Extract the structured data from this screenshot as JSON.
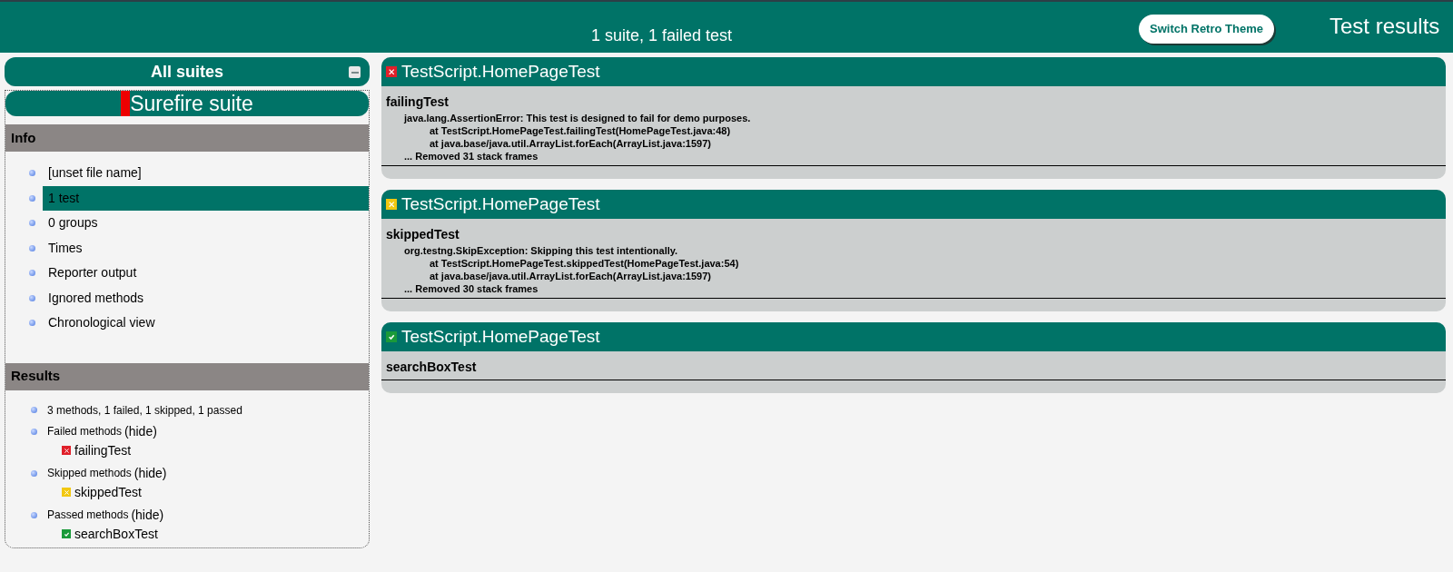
{
  "header": {
    "summary": "1 suite, 1 failed test",
    "theme_button": "Switch Retro Theme",
    "title": "Test results"
  },
  "sidebar": {
    "all_suites": "All suites",
    "suite": {
      "name": "Surefire suite",
      "failed": true
    },
    "info": {
      "heading": "Info",
      "items": [
        {
          "label": "[unset file name]",
          "selected": false
        },
        {
          "label": "1 test",
          "selected": true
        },
        {
          "label": "0 groups",
          "selected": false
        },
        {
          "label": "Times",
          "selected": false
        },
        {
          "label": "Reporter output",
          "selected": false
        },
        {
          "label": "Ignored methods",
          "selected": false
        },
        {
          "label": "Chronological view",
          "selected": false
        }
      ]
    },
    "results": {
      "heading": "Results",
      "summary": "3 methods, 1 failed, 1 skipped, 1 passed",
      "groups": [
        {
          "label": "Failed methods",
          "toggle": "(hide)",
          "kind": "failed",
          "methods": [
            "failingTest"
          ]
        },
        {
          "label": "Skipped methods",
          "toggle": "(hide)",
          "kind": "skipped",
          "methods": [
            "skippedTest"
          ]
        },
        {
          "label": "Passed methods",
          "toggle": "(hide)",
          "kind": "passed",
          "methods": [
            "searchBoxTest"
          ]
        }
      ]
    }
  },
  "classes": [
    {
      "name": "TestScript.HomePageTest",
      "kind": "failed",
      "method": "failingTest",
      "trace": [
        "java.lang.AssertionError: This test is designed to fail for demo purposes.",
        "at TestScript.HomePageTest.failingTest(HomePageTest.java:48)",
        "at java.base/java.util.ArrayList.forEach(ArrayList.java:1597)",
        "... Removed 31 stack frames"
      ]
    },
    {
      "name": "TestScript.HomePageTest",
      "kind": "skipped",
      "method": "skippedTest",
      "trace": [
        "org.testng.SkipException: Skipping this test intentionally.",
        "at TestScript.HomePageTest.skippedTest(HomePageTest.java:54)",
        "at java.base/java.util.ArrayList.forEach(ArrayList.java:1597)",
        "... Removed 30 stack frames"
      ]
    },
    {
      "name": "TestScript.HomePageTest",
      "kind": "passed",
      "method": "searchBoxTest"
    }
  ]
}
